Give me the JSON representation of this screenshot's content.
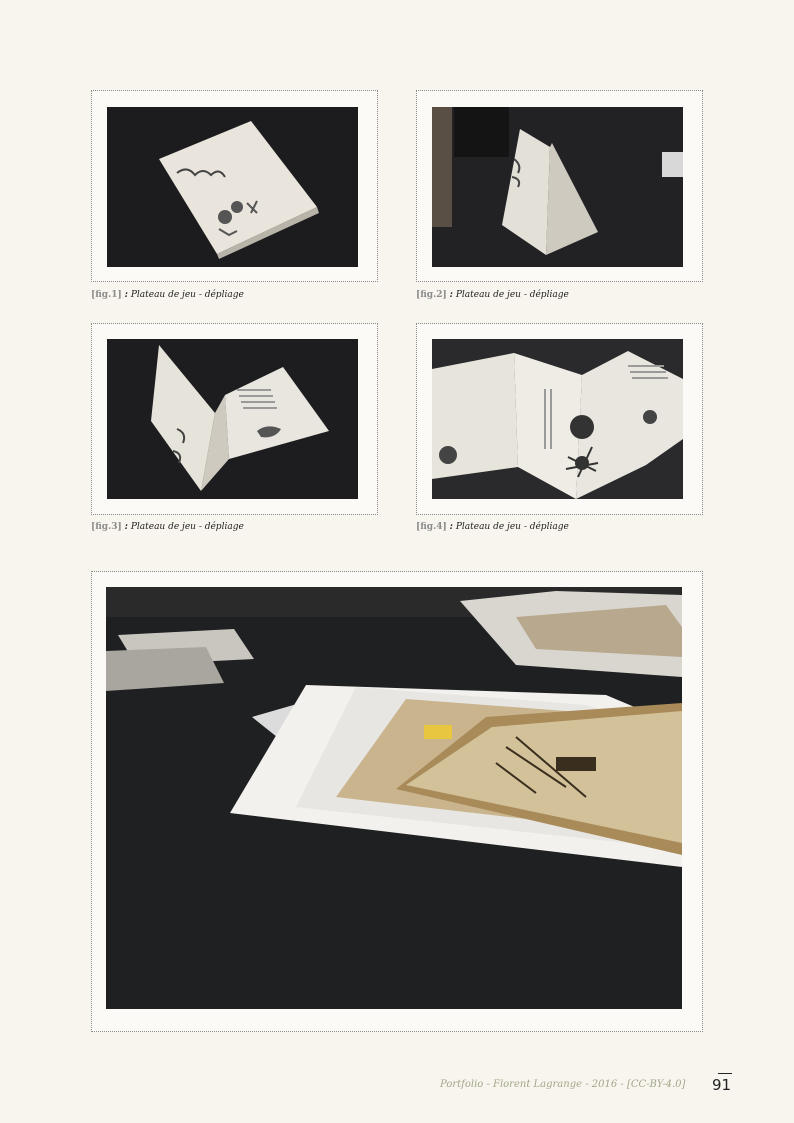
{
  "figures": [
    {
      "fig_label": "[fig.1]",
      "separator": ":",
      "title": "Plateau de jeu - dépliage"
    },
    {
      "fig_label": "[fig.2]",
      "separator": ":",
      "title": "Plateau de jeu - dépliage"
    },
    {
      "fig_label": "[fig.3]",
      "separator": ":",
      "title": "Plateau de jeu - dépliage"
    },
    {
      "fig_label": "[fig.4]",
      "separator": ":",
      "title": "Plateau de jeu - dépliage"
    }
  ],
  "footer": {
    "credit": "Portfolio - Florent Lagrange - 2016 - [CC-BY-4.0]",
    "page_number": "91"
  },
  "colors": {
    "page_background": "#f8f5ee",
    "photo_background": "#1d1d1f",
    "footer_text": "#a3a68a"
  }
}
